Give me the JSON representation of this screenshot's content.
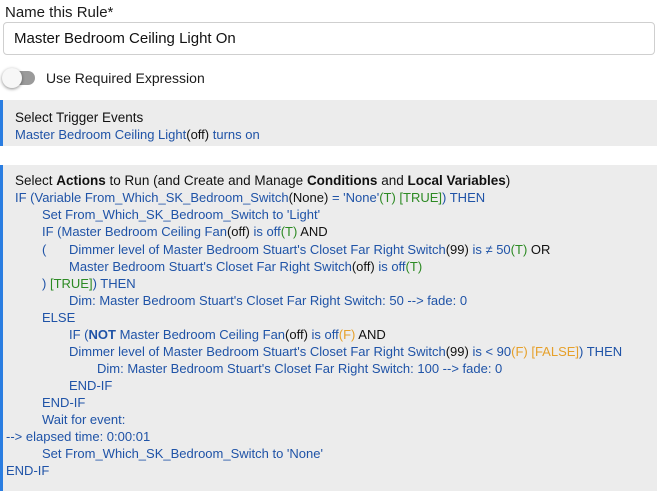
{
  "rule_name": {
    "label": "Name this Rule*",
    "value": "Master Bedroom Ceiling Light On"
  },
  "required_expression": {
    "label": "Use Required Expression",
    "enabled": false
  },
  "trigger_section": {
    "heading": "Select Trigger Events",
    "trigger": {
      "device": "Master Bedroom Ceiling Light",
      "state": "(off)",
      "rest": " turns on"
    }
  },
  "actions_section": {
    "heading": {
      "p1": "Select ",
      "actions": "Actions",
      "p2": " to Run (and Create and Manage ",
      "conditions": "Conditions",
      "p3": " and ",
      "local_vars": "Local Variables",
      "p4": ")"
    },
    "lines": {
      "l1a": "IF (Variable From_Which_SK_Bedroom_Switch",
      "l1b": "(None)",
      "l1c": " = 'None'",
      "l1d": "(T) [TRUE]",
      "l1e": ") THEN",
      "l2": "Set From_Which_SK_Bedroom_Switch to 'Light'",
      "l3a": "IF (Master Bedroom Ceiling Fan",
      "l3b": "(off)",
      "l3c": " is off",
      "l3d": "(T)",
      "l3e": "  AND",
      "l4a": "(",
      "l4b": "Dimmer level of Master Bedroom Stuart's Closet Far Right Switch",
      "l4c": "(99)",
      "l4d": " is ≠ 50",
      "l4e": "(T)",
      "l4f": "  OR",
      "l5a": "Master Bedroom Stuart's Closet Far Right Switch",
      "l5b": "(off)",
      "l5c": " is off",
      "l5d": "(T)",
      "l6a": ") ",
      "l6b": "[TRUE]",
      "l6c": ") THEN",
      "l7": "Dim: Master Bedroom Stuart's Closet Far Right Switch: 50 --> fade: 0",
      "l8": "ELSE",
      "l9a": "IF (",
      "l9b": "NOT",
      "l9c": " Master Bedroom Ceiling Fan",
      "l9d": "(off)",
      "l9e": " is off",
      "l9f": "(F)",
      "l9g": "  AND",
      "l10a": "Dimmer level of Master Bedroom Stuart's Closet Far Right Switch",
      "l10b": "(99)",
      "l10c": " is < 90",
      "l10d": "(F) [FALSE]",
      "l10e": ") THEN",
      "l11": "Dim: Master Bedroom Stuart's Closet Far Right Switch: 100 --> fade: 0",
      "l12": "END-IF",
      "l13": "END-IF",
      "l14": "Wait for event:",
      "l15": "--> elapsed time: 0:00:01",
      "l16": "Set From_Which_SK_Bedroom_Switch to 'None'",
      "l17": "END-IF"
    }
  },
  "colors": {
    "accent": "#2a7de1",
    "text_blue": "#1f53a7",
    "true_green": "#2c8a23",
    "false_orange": "#e6a02a",
    "card_bg": "#ececec"
  }
}
